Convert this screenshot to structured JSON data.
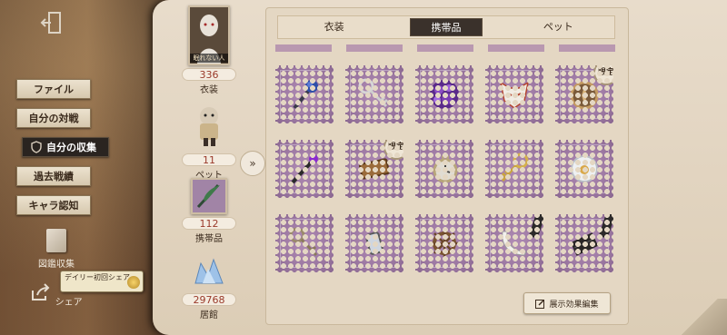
{
  "nav": {
    "exit_icon": "exit-door-icon",
    "menu": [
      {
        "label": "ファイル"
      },
      {
        "label": "自分の対戦"
      },
      {
        "label": "自分の収集",
        "active": true
      },
      {
        "label": "過去戦績"
      },
      {
        "label": "キャラ認知"
      }
    ],
    "encyclopedia_label": "図鑑収集",
    "share_label": "シェア",
    "daily_tip": "デイリー初回シェア"
  },
  "stats": {
    "costume": {
      "count": "336",
      "label": "衣装",
      "portrait_caption": "眠れない人"
    },
    "pet": {
      "count": "11",
      "label": "ペット"
    },
    "accessory": {
      "count": "112",
      "label": "携帯品"
    },
    "residence": {
      "count": "29768",
      "label": "居館"
    }
  },
  "tabs": [
    {
      "label": "衣装",
      "active": false
    },
    {
      "label": "携帯品",
      "active": true
    },
    {
      "label": "ペット",
      "active": false
    }
  ],
  "limited_label": "限定",
  "items": [
    {
      "icon": "blue-rose-scepter-icon",
      "limited": false,
      "tagged": false
    },
    {
      "icon": "silver-key-icon",
      "limited": false,
      "tagged": false
    },
    {
      "icon": "purple-bubbles-icon",
      "limited": false,
      "tagged": false
    },
    {
      "icon": "fox-mask-icon",
      "limited": false,
      "tagged": false
    },
    {
      "icon": "bronze-compass-icon",
      "limited": true,
      "tagged": false
    },
    {
      "icon": "violet-staff-icon",
      "limited": false,
      "tagged": false
    },
    {
      "icon": "wooden-plaque-icon",
      "limited": true,
      "tagged": false
    },
    {
      "icon": "pocket-watch-icon",
      "limited": false,
      "tagged": false
    },
    {
      "icon": "gold-key-icon",
      "limited": false,
      "tagged": false
    },
    {
      "icon": "crystal-orb-icon",
      "limited": false,
      "tagged": false
    },
    {
      "icon": "ornate-key-icon",
      "limited": false,
      "tagged": false
    },
    {
      "icon": "lantern-icon",
      "limited": false,
      "tagged": false
    },
    {
      "icon": "ship-wheel-icon",
      "limited": false,
      "tagged": false
    },
    {
      "icon": "white-scarf-icon",
      "limited": false,
      "tagged": true
    },
    {
      "icon": "black-fan-icon",
      "limited": false,
      "tagged": true
    }
  ],
  "edit_button_label": "展示効果編集"
}
